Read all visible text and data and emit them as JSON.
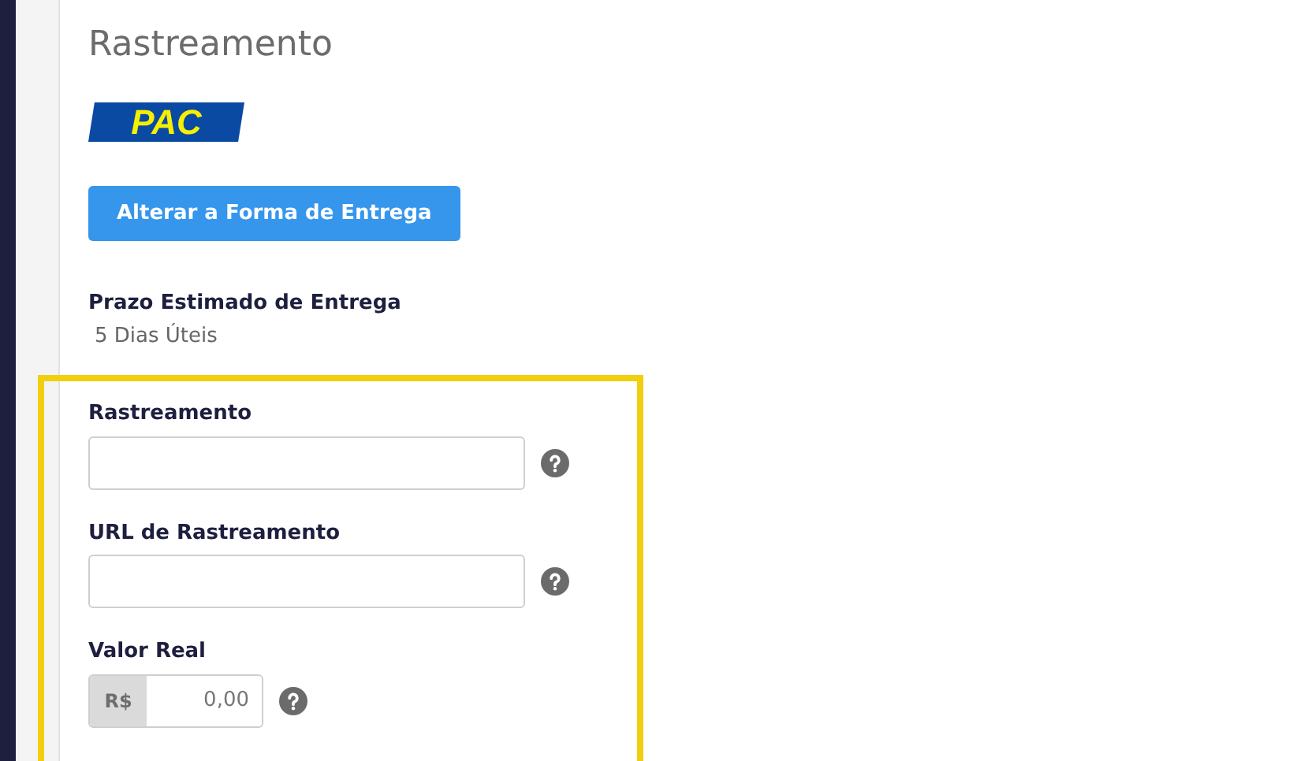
{
  "title": "Rastreamento",
  "carrier_logo": {
    "text": "PAC"
  },
  "change_button": "Alterar a Forma de Entrega",
  "estimate": {
    "label": "Prazo Estimado de Entrega",
    "value": "5 Dias Úteis"
  },
  "highlight": {
    "on": true
  },
  "fields": [
    {
      "kind": "text",
      "label": "Rastreamento"
    },
    {
      "kind": "text",
      "label": "URL de Rastreamento"
    },
    {
      "kind": "currency",
      "label": "Valor Real",
      "prefix": "R$",
      "value": "0,00"
    }
  ]
}
